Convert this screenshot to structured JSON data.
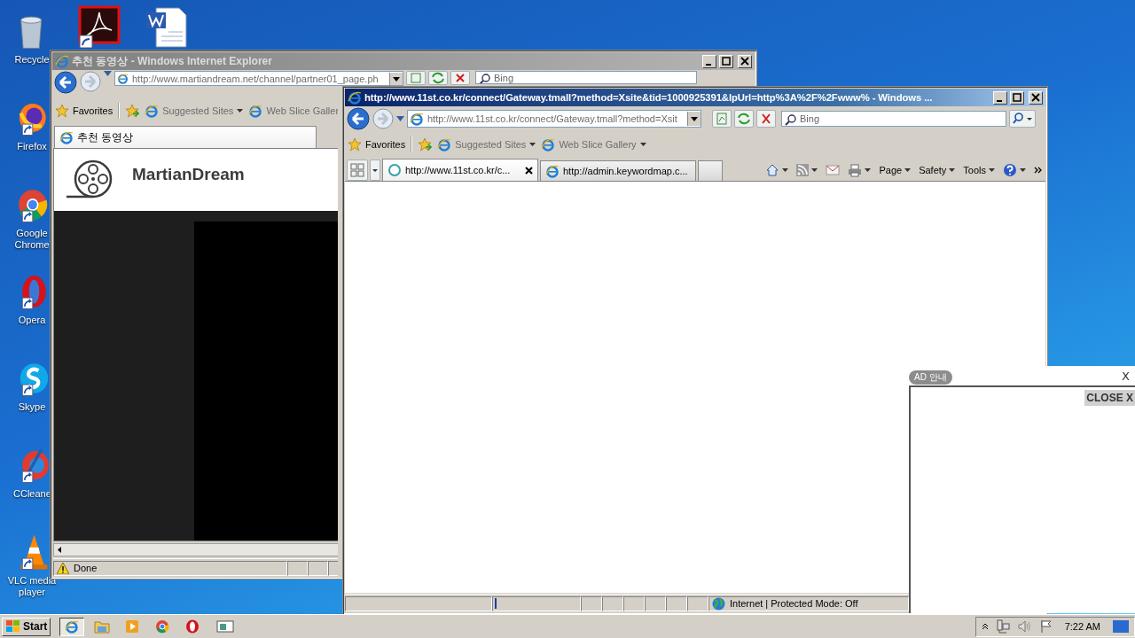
{
  "desktop": {
    "icons": [
      {
        "kind": "recycle",
        "label": "Recycle"
      },
      {
        "kind": "firefox",
        "label": "Firefox"
      },
      {
        "kind": "chrome",
        "label": "Google Chrome"
      },
      {
        "kind": "opera",
        "label": "Opera"
      },
      {
        "kind": "skype",
        "label": "Skype"
      },
      {
        "kind": "ccleaner",
        "label": "CCleane"
      },
      {
        "kind": "vlc",
        "label": "VLC media player"
      }
    ]
  },
  "back_window": {
    "title": "추천 동영상 - Windows Internet Explorer",
    "active": false,
    "address": "http://www.martiandream.net/channel/partner01_page.ph",
    "search_placeholder": "Bing",
    "favorites": [
      {
        "label": "Favorites",
        "dropdown": false
      },
      {
        "label": "Suggested Sites",
        "dropdown": true
      },
      {
        "label": "Web Slice Galler",
        "dropdown": false
      }
    ],
    "tabs": [
      {
        "label": "추천 동영상",
        "selected": true,
        "loading": false
      }
    ],
    "site_logo": "MartianDream",
    "status": "Done"
  },
  "front_window": {
    "title": "http://www.11st.co.kr/connect/Gateway.tmall?method=Xsite&tid=1000925391&lpUrl=http%3A%2F%2Fwww% - Windows ...",
    "active": true,
    "address": "http://www.11st.co.kr/connect/Gateway.tmall?method=Xsit",
    "search_placeholder": "Bing",
    "favorites": [
      {
        "label": "Favorites",
        "dropdown": false
      },
      {
        "label": "Suggested Sites",
        "dropdown": true
      },
      {
        "label": "Web Slice Gallery",
        "dropdown": true
      }
    ],
    "tabs": [
      {
        "label": "http://www.11st.co.kr/c...",
        "selected": true,
        "loading": true
      },
      {
        "label": "http://admin.keywordmap.c...",
        "selected": false,
        "loading": false
      }
    ],
    "commands": [
      {
        "label": "Page"
      },
      {
        "label": "Safety"
      },
      {
        "label": "Tools"
      }
    ],
    "progress": {
      "level": 0.02
    },
    "status": "Internet | Protected Mode: Off"
  },
  "ad_popup": {
    "badge": "AD 안내",
    "close_mark": "X",
    "close_button": "CLOSE X"
  },
  "taskbar": {
    "start": "Start",
    "apps": [
      {
        "kind": "ie",
        "selected": true
      },
      {
        "kind": "folder",
        "selected": false
      },
      {
        "kind": "media",
        "selected": false
      },
      {
        "kind": "chrome",
        "selected": false
      },
      {
        "kind": "opera",
        "selected": false
      },
      {
        "kind": "window",
        "selected": false
      }
    ],
    "clock": "7:22 AM"
  }
}
